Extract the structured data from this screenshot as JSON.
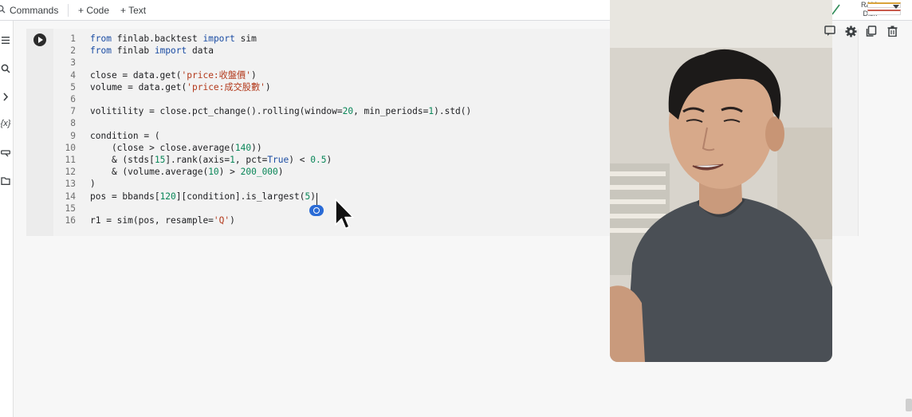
{
  "toolbar": {
    "commands_label": "Commands",
    "code_label": "+ Code",
    "text_label": "+ Text"
  },
  "resources": {
    "ram_label": "RAM",
    "disk_label": "Disk"
  },
  "cell_tools": {
    "icons": [
      "comment-icon",
      "gear-icon",
      "copy-icon",
      "trash-icon"
    ]
  },
  "sidebar": {
    "icons": [
      "menu-icon",
      "search-icon",
      "chevron-right-icon",
      "variables-icon",
      "key-icon",
      "folder-icon"
    ]
  },
  "cell": {
    "lines": [
      {
        "n": "1",
        "code": "from finlab.backtest import sim"
      },
      {
        "n": "2",
        "code": "from finlab import data"
      },
      {
        "n": "3",
        "code": ""
      },
      {
        "n": "4",
        "code": "close = data.get('price:收盤價')"
      },
      {
        "n": "5",
        "code": "volume = data.get('price:成交股數')"
      },
      {
        "n": "6",
        "code": ""
      },
      {
        "n": "7",
        "code": "volitility = close.pct_change().rolling(window=20, min_periods=1).std()"
      },
      {
        "n": "8",
        "code": ""
      },
      {
        "n": "9",
        "code": "condition = ("
      },
      {
        "n": "10",
        "code": "    (close > close.average(140))"
      },
      {
        "n": "11",
        "code": "    & (stds[15].rank(axis=1, pct=True) < 0.5)"
      },
      {
        "n": "12",
        "code": "    & (volume.average(10) > 200_000)"
      },
      {
        "n": "13",
        "code": ")"
      },
      {
        "n": "14",
        "code": "pos = bbands[120][condition].is_largest(5)"
      },
      {
        "n": "15",
        "code": ""
      },
      {
        "n": "16",
        "code": "r1 = sim(pos, resample='Q')"
      }
    ]
  }
}
